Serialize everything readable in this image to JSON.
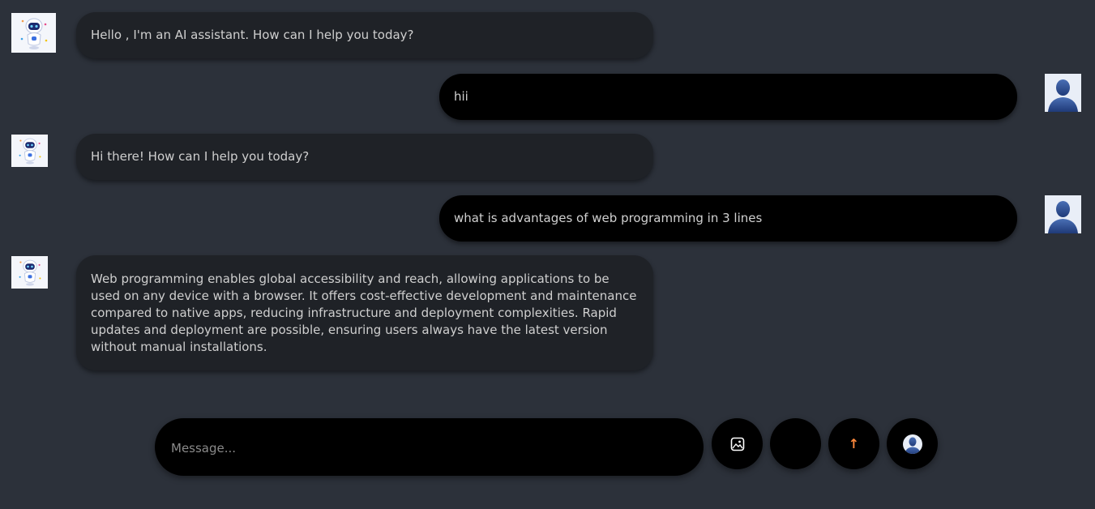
{
  "messages": [
    {
      "role": "bot",
      "text": "Hello , I'm an AI assistant. How can I help you today?"
    },
    {
      "role": "user",
      "text": "hii"
    },
    {
      "role": "bot",
      "text": "Hi there! How can I help you today?"
    },
    {
      "role": "user",
      "text": "what is advantages of web programming in 3 lines"
    },
    {
      "role": "bot",
      "text": "Web programming enables global accessibility and reach, allowing applications to be used on any device with a browser. It offers cost-effective development and maintenance compared to native apps, reducing infrastructure and deployment complexities. Rapid updates and deployment are possible, ensuring users always have the latest version without manual installations."
    }
  ],
  "composer": {
    "placeholder": "Message..."
  },
  "buttons": {
    "image_upload": {
      "icon": "image-icon"
    },
    "voice": {
      "icon": "blank"
    },
    "send": {
      "icon": "arrow-up-icon",
      "label": "↑",
      "color": "#ff8a3d"
    },
    "profile": {
      "icon": "user-avatar-icon"
    }
  },
  "colors": {
    "background": "#2c313a",
    "bot_bubble": "#1f2227",
    "user_bubble": "#000000",
    "accent": "#ff8a3d"
  }
}
